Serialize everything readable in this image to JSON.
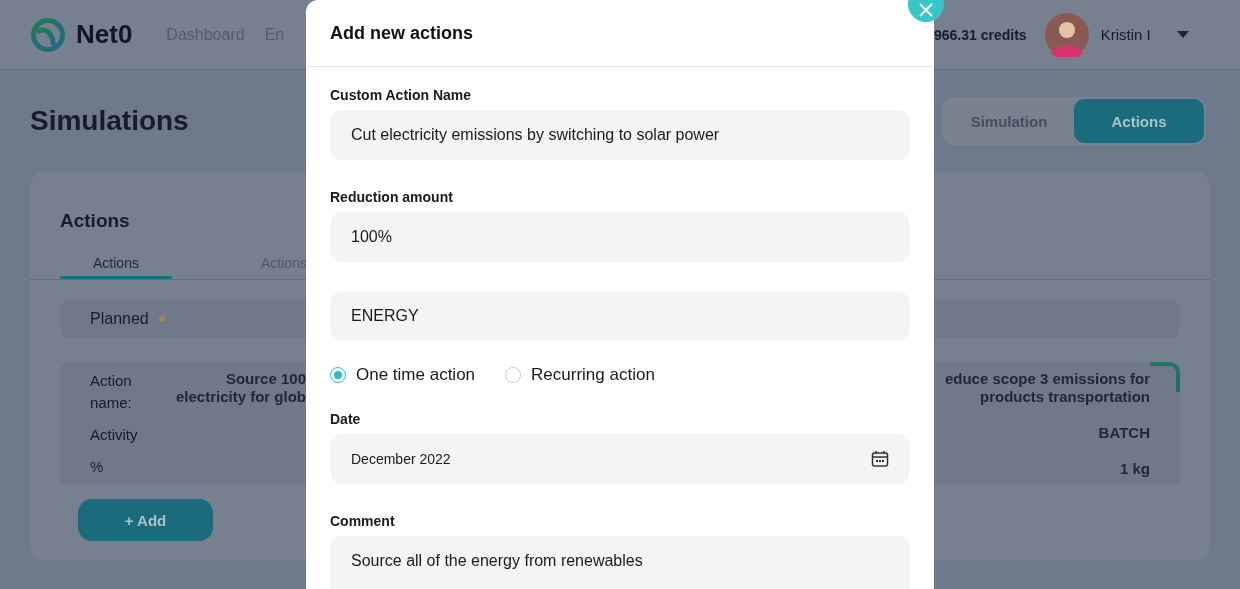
{
  "header": {
    "logo": "Net0",
    "nav": [
      "Dashboard",
      "En"
    ],
    "credits": "966.31 credits",
    "user": "Kristin I"
  },
  "page": {
    "title": "Simulations",
    "view_toggle": [
      {
        "label": "Simulation",
        "selected": false
      },
      {
        "label": "Actions",
        "selected": true
      }
    ]
  },
  "card": {
    "title": "Actions",
    "tabs": [
      {
        "label": "Actions",
        "selected": true
      },
      {
        "label": "Actions",
        "selected": false
      }
    ],
    "group": {
      "label": "Planned",
      "color": "#a08650"
    },
    "left_item": {
      "rows": [
        {
          "label": "Action name:",
          "value": [
            "Source 100",
            "electricity for glob"
          ]
        },
        {
          "label": "Activity"
        },
        {
          "label": "%"
        }
      ]
    },
    "right_item": {
      "values": [
        [
          "educe scope 3 emissions for",
          "products transportation"
        ],
        [
          "BATCH"
        ],
        [
          "1 kg"
        ]
      ]
    },
    "add_button": "+ Add"
  },
  "modal": {
    "title": "Add new actions",
    "fields": [
      {
        "kind": "text",
        "label": "Custom Action Name",
        "value": "Cut electricity emissions by switching to solar power"
      },
      {
        "kind": "text",
        "label": "Reduction amount",
        "value": "100%"
      },
      {
        "kind": "text",
        "value": "ENERGY"
      },
      {
        "kind": "radio",
        "options": [
          {
            "label": "One time action",
            "selected": true
          },
          {
            "label": "Recurring action",
            "selected": false
          }
        ]
      },
      {
        "kind": "date",
        "label": "Date",
        "value": "December 2022"
      },
      {
        "kind": "textarea",
        "label": "Comment",
        "value": "Source all of the energy from renewables"
      }
    ]
  }
}
